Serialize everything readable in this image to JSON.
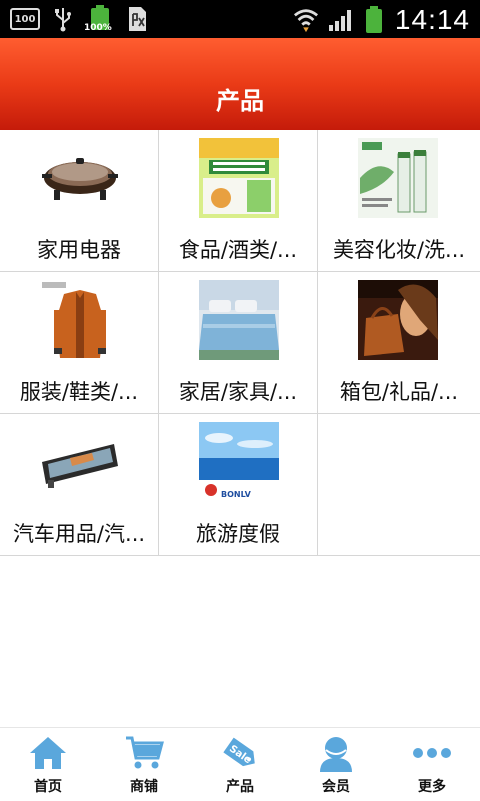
{
  "status_bar": {
    "left_box_text": "100",
    "battery_text": "100%",
    "time": "14:14"
  },
  "header": {
    "title": "产品"
  },
  "grid": {
    "items": [
      {
        "label": "家用电器",
        "image": "electric-skillet-image"
      },
      {
        "label": "食品/酒类/...",
        "image": "food-product-ad-image"
      },
      {
        "label": "美容化妆/洗...",
        "image": "cosmetics-bottles-image"
      },
      {
        "label": "服装/鞋类/...",
        "image": "suit-jacket-image"
      },
      {
        "label": "家居/家具/...",
        "image": "bedding-set-image"
      },
      {
        "label": "箱包/礼品/...",
        "image": "handbag-model-image"
      },
      {
        "label": "汽车用品/汽...",
        "image": "car-mirror-image"
      },
      {
        "label": "旅游度假",
        "image": "ocean-travel-ad-image"
      }
    ]
  },
  "ad_text": {
    "brand": "BONLV"
  },
  "bottom_nav": {
    "items": [
      {
        "label": "首页",
        "icon": "home-icon"
      },
      {
        "label": "商铺",
        "icon": "cart-icon"
      },
      {
        "label": "产品",
        "icon": "sale-tag-icon",
        "icon_text": "Sale"
      },
      {
        "label": "会员",
        "icon": "member-icon"
      },
      {
        "label": "更多",
        "icon": "more-dots-icon"
      }
    ]
  },
  "colors": {
    "header_top": "#ff5d30",
    "header_bottom": "#c51b0a",
    "nav_icon": "#5aa7dc"
  }
}
